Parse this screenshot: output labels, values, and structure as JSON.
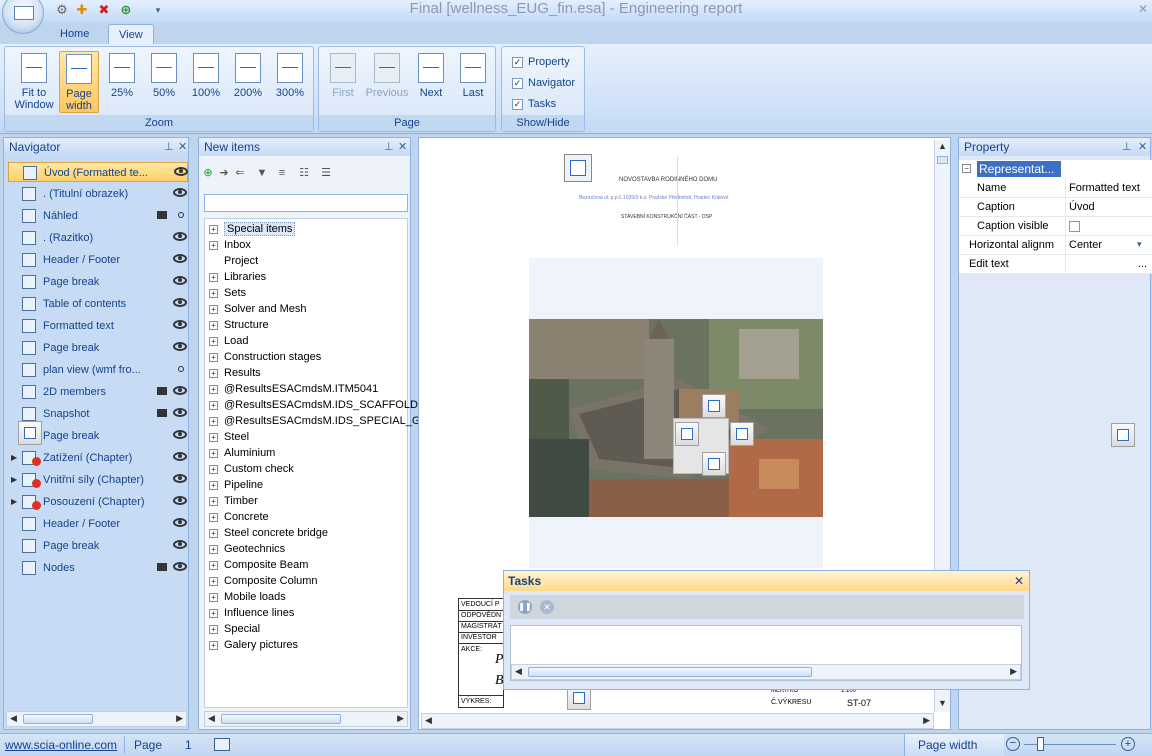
{
  "window": {
    "title": "Final [wellness_EUG_fin.esa] - Engineering report",
    "tabs": [
      {
        "label": "Home"
      },
      {
        "label": "View"
      }
    ]
  },
  "ribbon": {
    "zoom": {
      "label": "Zoom",
      "buttons": [
        {
          "label": "Fit to Window"
        },
        {
          "label": "Page width"
        },
        {
          "label": "25%"
        },
        {
          "label": "50%"
        },
        {
          "label": "100%"
        },
        {
          "label": "200%"
        },
        {
          "label": "300%"
        }
      ]
    },
    "page": {
      "label": "Page",
      "buttons": [
        {
          "label": "First"
        },
        {
          "label": "Previous"
        },
        {
          "label": "Next"
        },
        {
          "label": "Last"
        }
      ]
    },
    "showhide": {
      "label": "Show/Hide",
      "items": [
        {
          "label": "Property",
          "checked": true
        },
        {
          "label": "Navigator",
          "checked": true
        },
        {
          "label": "Tasks",
          "checked": true
        }
      ]
    }
  },
  "navigator": {
    "title": "Navigator",
    "items": [
      {
        "label": "Úvod (Formatted te..."
      },
      {
        "label": ". (Titulní obrazek)"
      },
      {
        "label": "Náhled"
      },
      {
        "label": ". (Razitko)"
      },
      {
        "label": "Header / Footer"
      },
      {
        "label": "Page break"
      },
      {
        "label": "Table of contents"
      },
      {
        "label": "Formatted text"
      },
      {
        "label": "Page break"
      },
      {
        "label": "plan view (wmf fro..."
      },
      {
        "label": "2D members"
      },
      {
        "label": "Snapshot"
      },
      {
        "label": "Page break"
      },
      {
        "label": "Zatížení (Chapter)"
      },
      {
        "label": "Vnitřní síly (Chapter)"
      },
      {
        "label": "Posouzení (Chapter)"
      },
      {
        "label": "Header / Footer"
      },
      {
        "label": "Page break"
      },
      {
        "label": "Nodes"
      }
    ]
  },
  "newitems": {
    "title": "New items",
    "tree": [
      "Special items",
      "Inbox",
      "Project",
      "Libraries",
      "Sets",
      "Solver and Mesh",
      "Structure",
      "Load",
      "Construction stages",
      "Results",
      "@ResultsESACmdsM.ITM5041",
      "@ResultsESACmdsM.IDS_SCAFFOLDI",
      "@ResultsESACmdsM.IDS_SPECIAL_GI",
      "Steel",
      "Aluminium",
      "Custom check",
      "Pipeline",
      "Timber",
      "Concrete",
      "Steel concrete bridge",
      "Geotechnics",
      "Composite Beam",
      "Composite Column",
      "Mobile loads",
      "Influence lines",
      "Special",
      "Galery pictures"
    ]
  },
  "document": {
    "header_lines": [
      "NOVOSTAVBA RODINNÉHO DOMU",
      "Bezručova ul. p.p.č.1039/3 k.ú. Pražské Předměstí, Hradec Králové",
      "STAVEBNÍ KONSTRUKČNÍ ČÁST - DSP"
    ],
    "stamp_rows": [
      "VEDOUCÍ P",
      "ODPOVĚDN",
      "MAGISTRÁT",
      "INVESTOR",
      "AKCE:",
      "VÝKRES:"
    ],
    "stamp_right": [
      "MĚŘÍTKO",
      "1:100",
      "Č.VÝKRESU",
      "ST-07"
    ],
    "stamp_big": [
      "P",
      "B"
    ]
  },
  "property": {
    "title": "Property",
    "group": "Representat...",
    "rows": [
      {
        "name": "Name",
        "value": "Formatted text"
      },
      {
        "name": "Caption",
        "value": "Úvod"
      },
      {
        "name": "Caption visible",
        "value": ""
      },
      {
        "name": "Horizontal alignm...",
        "value": "Center"
      },
      {
        "name": "Edit text",
        "value": "..."
      }
    ]
  },
  "tasks": {
    "title": "Tasks"
  },
  "status": {
    "link": "www.scia-online.com",
    "page_label": "Page",
    "page_number": "1",
    "zoom_mode": "Page width"
  }
}
